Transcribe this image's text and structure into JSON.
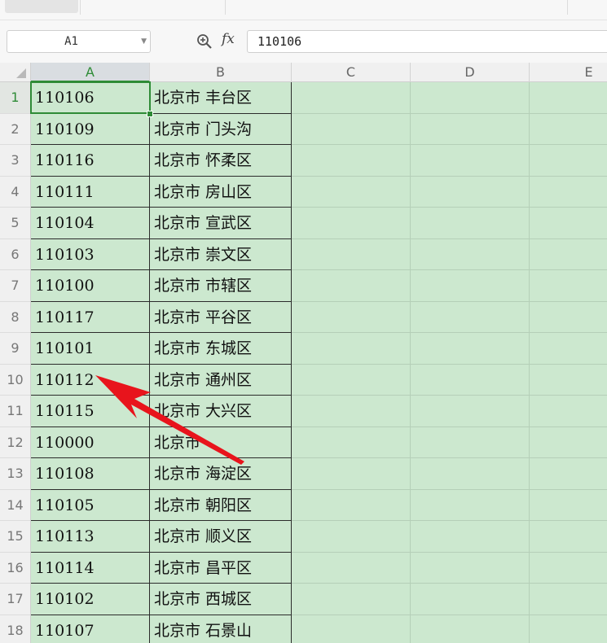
{
  "formula_bar": {
    "name_box": "A1",
    "fx_label": "fx",
    "formula_value": "110106"
  },
  "columns": [
    "A",
    "B",
    "C",
    "D",
    "E"
  ],
  "rows": [
    {
      "n": "1",
      "a": "110106",
      "b": "北京市 丰台区"
    },
    {
      "n": "2",
      "a": "110109",
      "b": "北京市 门头沟"
    },
    {
      "n": "3",
      "a": "110116",
      "b": "北京市 怀柔区"
    },
    {
      "n": "4",
      "a": "110111",
      "b": "北京市 房山区"
    },
    {
      "n": "5",
      "a": "110104",
      "b": "北京市 宣武区"
    },
    {
      "n": "6",
      "a": "110103",
      "b": "北京市 崇文区"
    },
    {
      "n": "7",
      "a": "110100",
      "b": "北京市 市辖区"
    },
    {
      "n": "8",
      "a": "110117",
      "b": "北京市 平谷区"
    },
    {
      "n": "9",
      "a": "110101",
      "b": "北京市 东城区"
    },
    {
      "n": "10",
      "a": "110112",
      "b": "北京市 通州区"
    },
    {
      "n": "11",
      "a": "110115",
      "b": "北京市 大兴区"
    },
    {
      "n": "12",
      "a": "110000",
      "b": "北京市"
    },
    {
      "n": "13",
      "a": "110108",
      "b": "北京市 海淀区"
    },
    {
      "n": "14",
      "a": "110105",
      "b": "北京市 朝阳区"
    },
    {
      "n": "15",
      "a": "110113",
      "b": "北京市 顺义区"
    },
    {
      "n": "16",
      "a": "110114",
      "b": "北京市 昌平区"
    },
    {
      "n": "17",
      "a": "110102",
      "b": "北京市 西城区"
    },
    {
      "n": "18",
      "a": "110107",
      "b": "北京市 石景山"
    }
  ],
  "colors": {
    "cell_fill": "#cce8cf",
    "selection": "#2e8b36",
    "arrow": "#e8141c"
  }
}
